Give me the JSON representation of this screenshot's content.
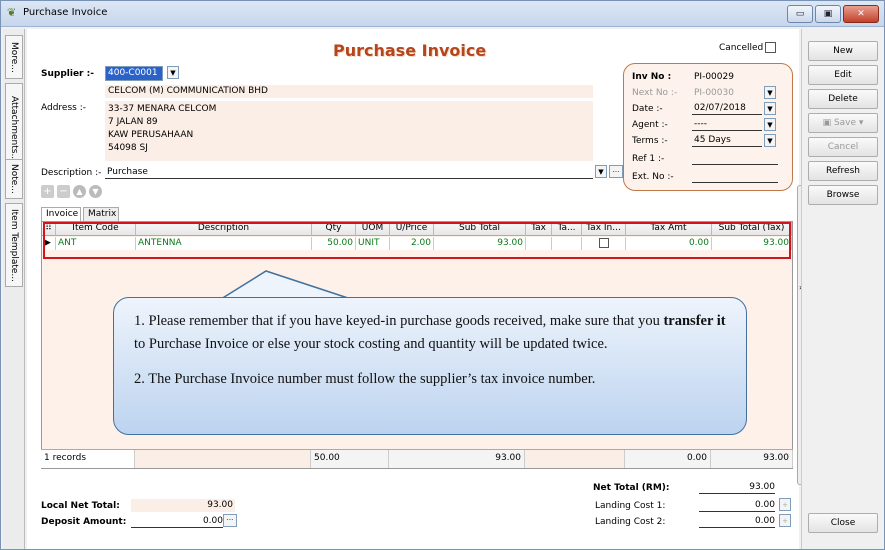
{
  "window": {
    "title": "Purchase Invoice",
    "min": "▭",
    "max": "▣",
    "close": "✕"
  },
  "side_tabs": [
    "More...",
    "Attachments...",
    "Note...",
    "Item Template..."
  ],
  "header": {
    "title": "Purchase Invoice",
    "cancelled_label": "Cancelled"
  },
  "supplier": {
    "label": "Supplier :-",
    "code": "400-C0001",
    "name": "CELCOM (M) COMMUNICATION BHD"
  },
  "address": {
    "label": "Address :-",
    "lines": [
      "33-37 MENARA CELCOM",
      "7 JALAN 89",
      "KAW PERUSAHAAN",
      "54098 SJ"
    ]
  },
  "description": {
    "label": "Description :-",
    "value": "Purchase",
    "more": "···"
  },
  "info": {
    "inv_no_label": "Inv No :",
    "inv_no": "PI-00029",
    "next_no_label": "Next No :-",
    "next_no": "PI-00030",
    "date_label": "Date :-",
    "date": "02/07/2018",
    "agent_label": "Agent :-",
    "agent": "----",
    "terms_label": "Terms :-",
    "terms": "45 Days",
    "ref1_label": "Ref 1 :-",
    "ref1": "",
    "ext_no_label": "Ext. No :-",
    "ext_no": ""
  },
  "tabs": [
    "Invoice",
    "Matrix"
  ],
  "grid": {
    "headers": [
      "Item Code",
      "Description",
      "Qty",
      "UOM",
      "U/Price",
      "Sub Total",
      "Tax",
      "Ta...",
      "Tax In...",
      "Tax Amt",
      "Sub Total (Tax)"
    ],
    "row": {
      "item_code": "ANT",
      "description": "ANTENNA",
      "qty": "50.00",
      "uom": "UNIT",
      "uprice": "2.00",
      "subtotal": "93.00",
      "tax": "",
      "ta": "",
      "taxamt": "0.00",
      "subtotal_tax": "93.00"
    },
    "footer": {
      "records": "1 records",
      "qty": "50.00",
      "subtotal": "93.00",
      "taxamt": "0.00",
      "subtotal_tax": "93.00"
    }
  },
  "callout": {
    "p1_before": "1. Please remember that if you have keyed-in purchase goods received, make sure that you ",
    "p1_bold": "transfer it",
    "p1_after": " to Purchase Invoice or else your stock costing and quantity will be updated twice.",
    "p2": "2. The Purchase Invoice number must follow the supplier’s tax invoice number."
  },
  "totals": {
    "local_net_label": "Local Net Total:",
    "local_net": "93.00",
    "deposit_label": "Deposit Amount:",
    "deposit": "0.00",
    "net_total_label": "Net Total (RM):",
    "net_total": "93.00",
    "landing1_label": "Landing Cost 1:",
    "landing1": "0.00",
    "landing2_label": "Landing Cost 2:",
    "landing2": "0.00"
  },
  "actions": [
    "New",
    "Edit",
    "Delete",
    "Save",
    "Cancel",
    "Refresh",
    "Browse",
    "Close"
  ]
}
